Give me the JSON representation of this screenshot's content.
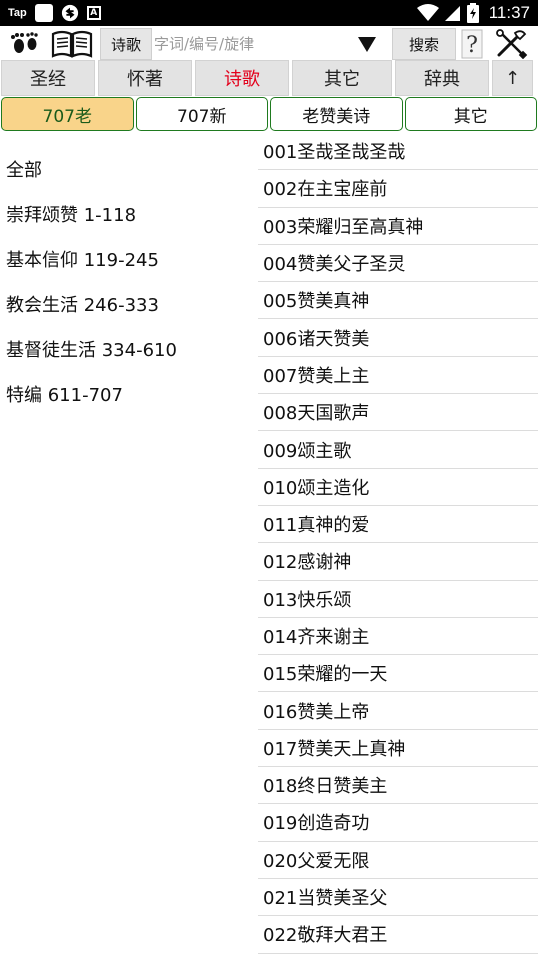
{
  "status_bar": {
    "app_label": "Tap",
    "time": "11:37",
    "a_badge": "A"
  },
  "toolbar": {
    "type_button": "诗歌",
    "search_placeholder": "字词/编号/旋律",
    "search_value": "",
    "search_button": "搜索",
    "help_label": "?"
  },
  "main_tabs": [
    {
      "label": "圣经"
    },
    {
      "label": "怀著"
    },
    {
      "label": "诗歌"
    },
    {
      "label": "其它"
    },
    {
      "label": "辞典"
    },
    {
      "label": "↑"
    }
  ],
  "sub_tabs": [
    {
      "label": "707老"
    },
    {
      "label": "707新"
    },
    {
      "label": "老赞美诗"
    },
    {
      "label": "其它"
    }
  ],
  "categories": [
    {
      "label": "全部"
    },
    {
      "label": "崇拜颂赞 1-118"
    },
    {
      "label": "基本信仰 119-245"
    },
    {
      "label": "教会生活 246-333"
    },
    {
      "label": "基督徒生活 334-610"
    },
    {
      "label": "特编 611-707"
    }
  ],
  "songs": [
    {
      "label": "001圣哉圣哉圣哉"
    },
    {
      "label": "002在主宝座前"
    },
    {
      "label": "003荣耀归至高真神"
    },
    {
      "label": "004赞美父子圣灵"
    },
    {
      "label": "005赞美真神"
    },
    {
      "label": "006诸天赞美"
    },
    {
      "label": "007赞美上主"
    },
    {
      "label": "008天国歌声"
    },
    {
      "label": "009颂主歌"
    },
    {
      "label": "010颂主造化"
    },
    {
      "label": "011真神的爱"
    },
    {
      "label": "012感谢神"
    },
    {
      "label": "013快乐颂"
    },
    {
      "label": "014齐来谢主"
    },
    {
      "label": "015荣耀的一天"
    },
    {
      "label": "016赞美上帝"
    },
    {
      "label": "017赞美天上真神"
    },
    {
      "label": "018终日赞美主"
    },
    {
      "label": "019创造奇功"
    },
    {
      "label": "020父爱无限"
    },
    {
      "label": "021当赞美圣父"
    },
    {
      "label": "022敬拜大君王"
    }
  ],
  "colors": {
    "active_main_tab_text": "#e3001b",
    "active_sub_tab_bg": "#f9d48a",
    "sub_tab_border": "#1f7a1f"
  },
  "icons": {
    "footprints": "footprints-icon",
    "book": "open-book-icon",
    "dropdown": "dropdown-arrow-icon",
    "help": "help-icon",
    "settings": "tools-icon"
  }
}
